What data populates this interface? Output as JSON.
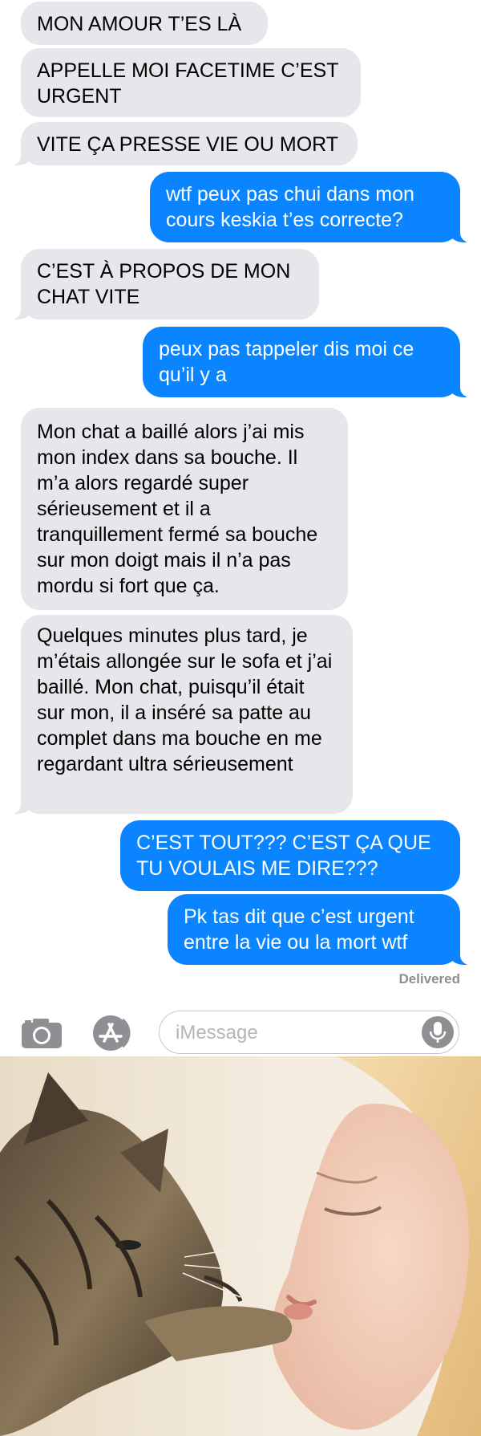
{
  "messages": [
    {
      "dir": "received",
      "text": "MON AMOUR T’ES LÀ"
    },
    {
      "dir": "received",
      "text": "APPELLE MOI FACETIME C’EST URGENT"
    },
    {
      "dir": "received",
      "text": "VITE ÇA PRESSE VIE OU MORT"
    },
    {
      "dir": "sent",
      "text": "wtf peux pas chui dans mon cours keskia t’es correcte?"
    },
    {
      "dir": "received",
      "text": "C’EST À PROPOS DE MON CHAT VITE"
    },
    {
      "dir": "sent",
      "text": "peux pas tappeler dis moi ce qu’il y a"
    },
    {
      "dir": "received",
      "text": "Mon chat a baillé alors j’ai mis mon index dans sa bouche. Il m’a alors regardé super sérieusement et il a tranquillement fermé sa bouche sur mon doigt mais il n’a pas mordu si fort que ça."
    },
    {
      "dir": "received",
      "text": "Quelques minutes plus tard, je m’étais allongée sur le sofa et j’ai baillé. Mon chat, puisqu’il était sur mon, il a inséré sa patte au complet dans ma bouche en me regardant ultra sérieusement"
    },
    {
      "dir": "sent",
      "text": "C’EST TOUT??? C’EST ÇA QUE TU VOULAIS ME DIRE???"
    },
    {
      "dir": "sent",
      "text": "Pk tas dit que c’est urgent entre la vie ou la mort wtf"
    }
  ],
  "status": "Delivered",
  "input": {
    "placeholder": "iMessage"
  },
  "icons": {
    "camera": "camera-icon",
    "apps": "app-store-icon",
    "mic": "microphone-icon"
  },
  "colors": {
    "sent": "#0b84ff",
    "received": "#e6e6eb",
    "background": "#ffffff"
  }
}
